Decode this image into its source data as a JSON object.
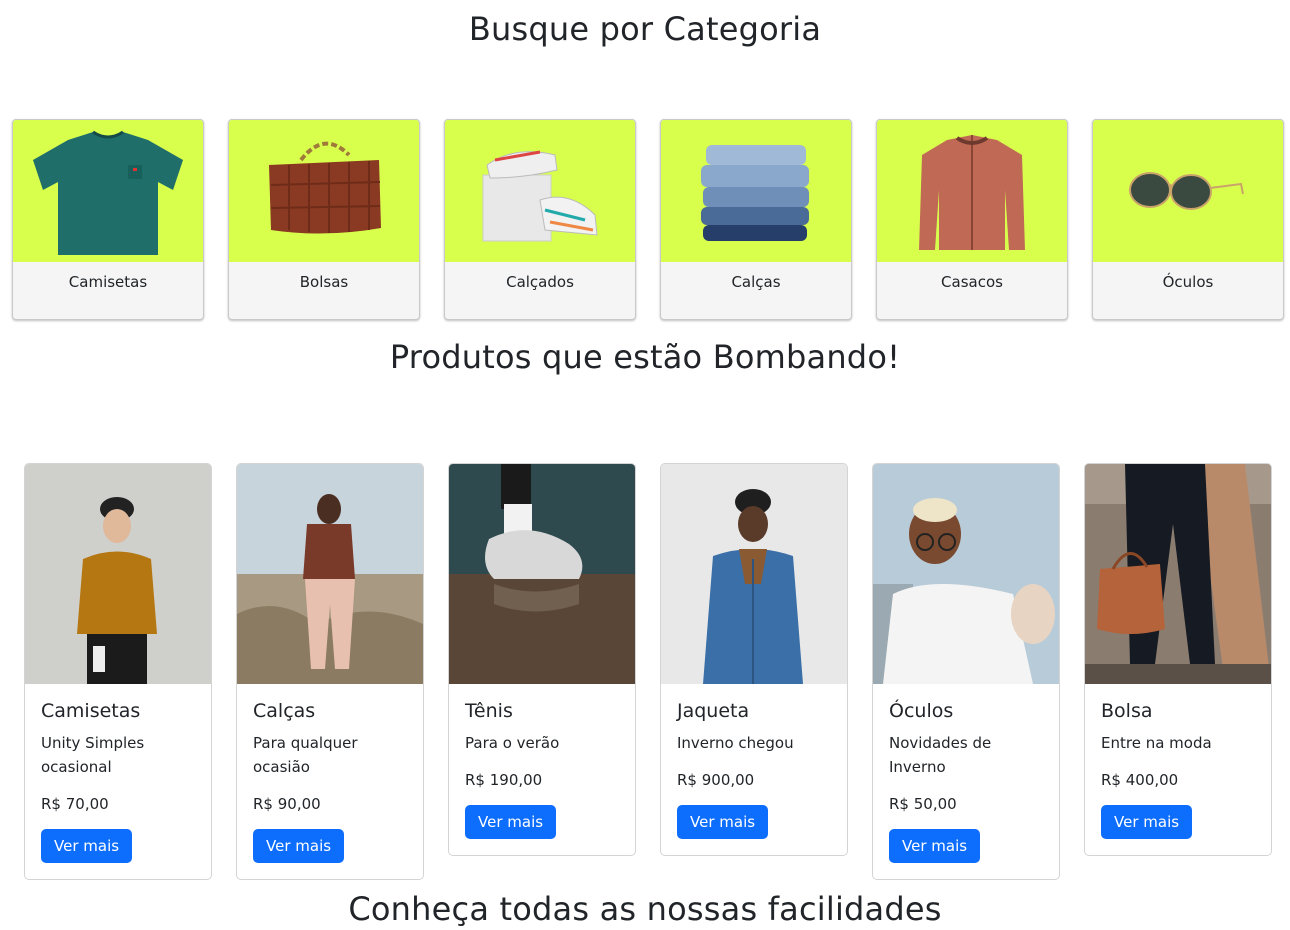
{
  "sections": {
    "categories_title": "Busque por Categoria",
    "products_title": "Produtos que estão Bombando!",
    "facilities_title": "Conheça todas as nossas facilidades"
  },
  "categories": [
    {
      "label": "Camisetas",
      "icon": "tshirt-image"
    },
    {
      "label": "Bolsas",
      "icon": "handbag-image"
    },
    {
      "label": "Calçados",
      "icon": "sneakers-image"
    },
    {
      "label": "Calças",
      "icon": "jeans-image"
    },
    {
      "label": "Casacos",
      "icon": "jacket-image"
    },
    {
      "label": "Óculos",
      "icon": "sunglasses-image"
    }
  ],
  "products": [
    {
      "title": "Camisetas",
      "description": "Unity Simples ocasional",
      "price": "R$ 70,00",
      "button": "Ver mais",
      "image": "man-mustard-shirt-photo"
    },
    {
      "title": "Calças",
      "description": "Para qualquer ocasião",
      "price": "R$ 90,00",
      "button": "Ver mais",
      "image": "woman-pink-pants-photo"
    },
    {
      "title": "Tênis",
      "description": "Para o verão",
      "price": "R$ 190,00",
      "button": "Ver mais",
      "image": "sneaker-puddle-photo"
    },
    {
      "title": "Jaqueta",
      "description": "Inverno chegou",
      "price": "R$ 900,00",
      "button": "Ver mais",
      "image": "man-denim-jacket-photo"
    },
    {
      "title": "Óculos",
      "description": "Novidades de Inverno",
      "price": "R$ 50,00",
      "button": "Ver mais",
      "image": "man-glasses-dog-photo"
    },
    {
      "title": "Bolsa",
      "description": "Entre na moda",
      "price": "R$ 400,00",
      "button": "Ver mais",
      "image": "woman-brown-bag-photo"
    }
  ],
  "colors": {
    "category_bg": "#d9ff4d",
    "button": "#0d6efd"
  }
}
